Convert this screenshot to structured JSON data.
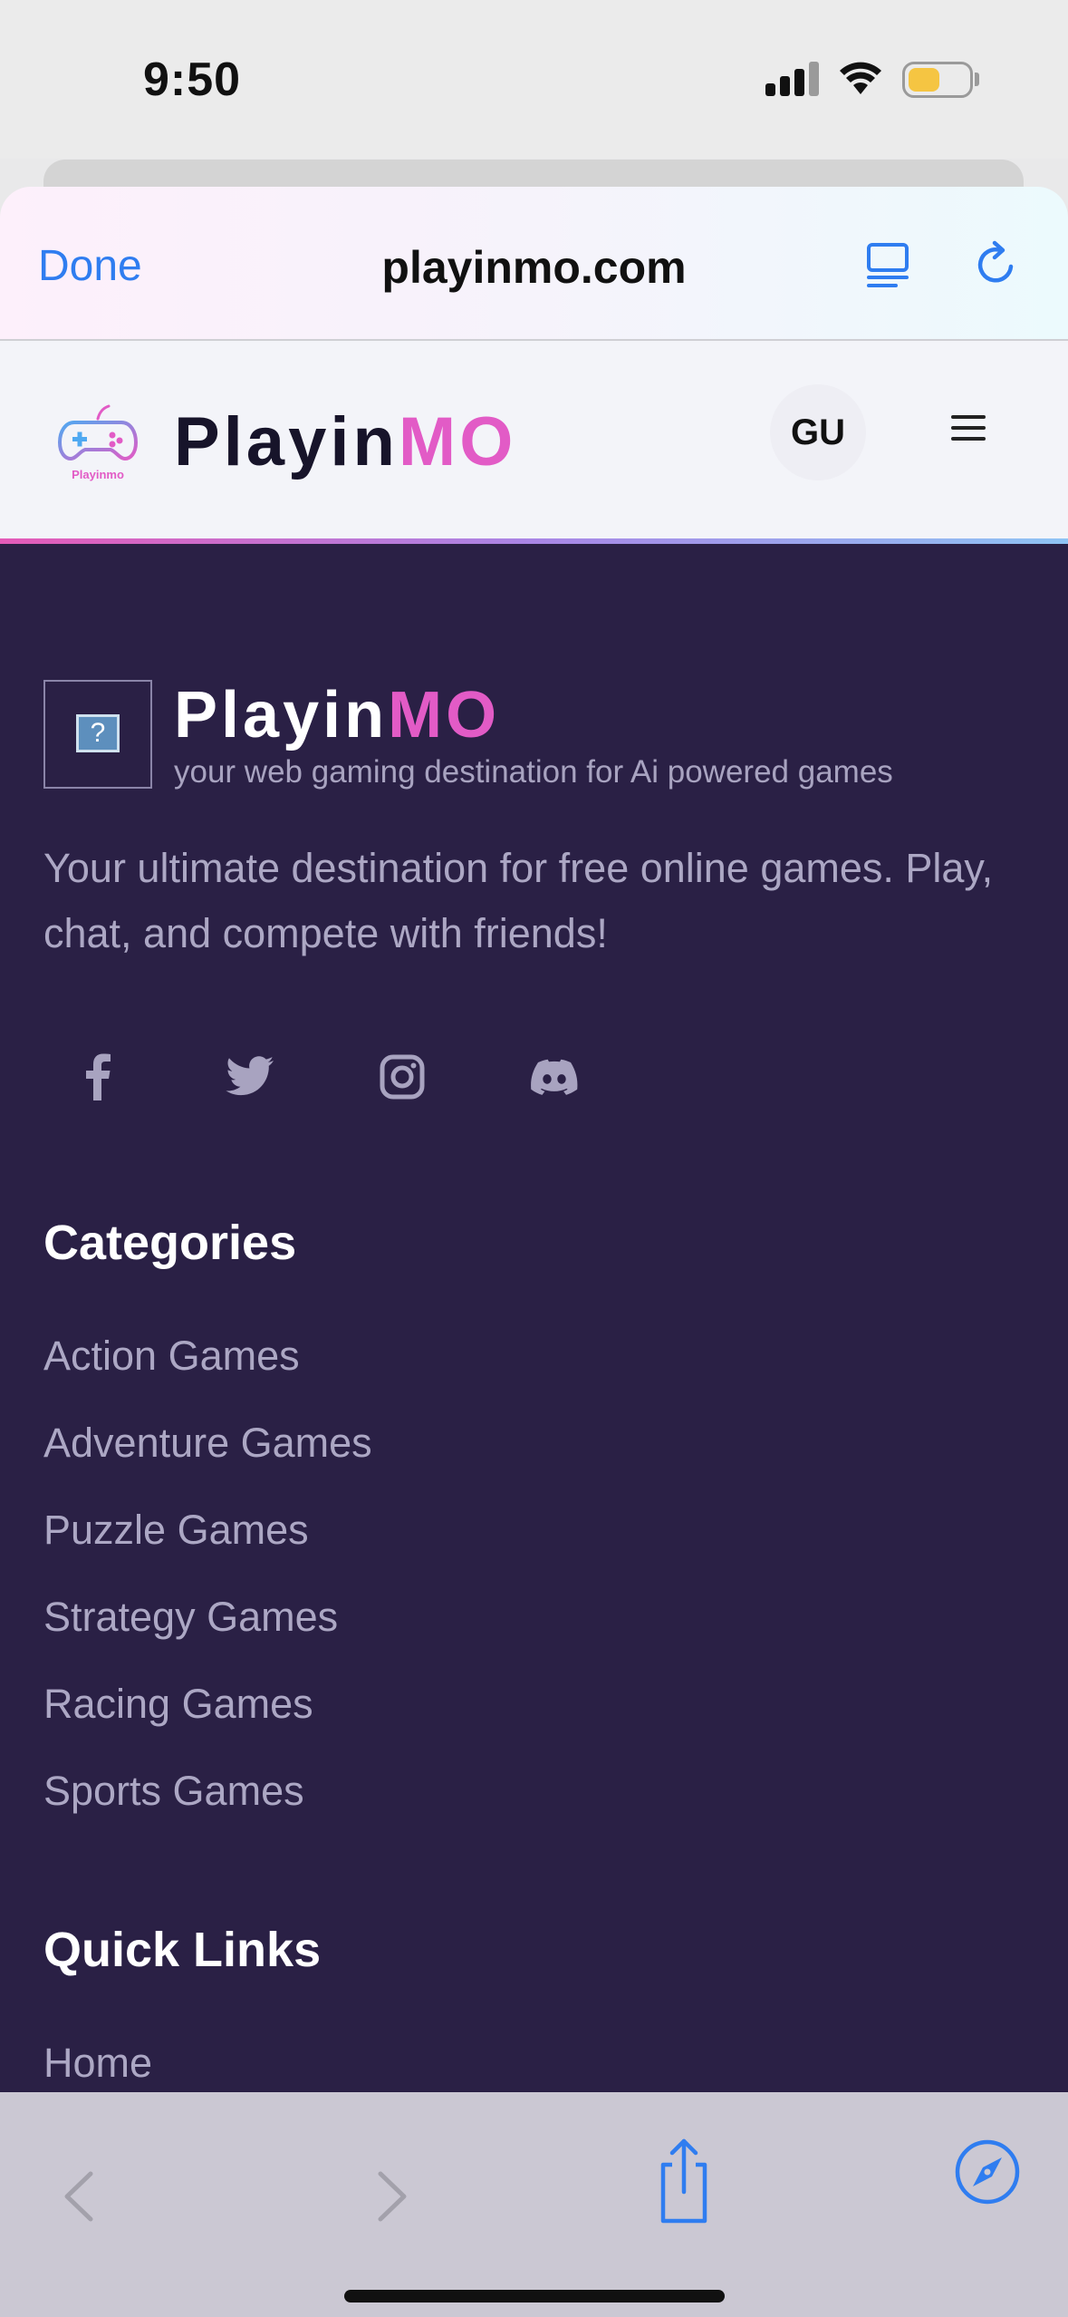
{
  "status_bar": {
    "time": "9:50"
  },
  "browser": {
    "done_label": "Done",
    "url": "playinmo.com"
  },
  "site_header": {
    "logo_part1": "Playin",
    "logo_part2": "MO",
    "logo_icon_text": "Playinmo",
    "language_label": "GU"
  },
  "footer": {
    "brand_part1": "Playin",
    "brand_part2": "MO",
    "broken_image_glyph": "?",
    "tagline": "your web gaming destination for Ai powered games",
    "description": "Your ultimate destination for free online games. Play, chat, and compete with friends!",
    "social_icons": [
      "facebook-icon",
      "twitter-icon",
      "instagram-icon",
      "discord-icon"
    ],
    "categories_title": "Categories",
    "categories": [
      "Action Games",
      "Adventure Games",
      "Puzzle Games",
      "Strategy Games",
      "Racing Games",
      "Sports Games"
    ],
    "quick_links_title": "Quick Links",
    "quick_links": [
      "Home"
    ]
  },
  "colors": {
    "accent": "#e25bc6",
    "footer_bg": "#2a2045",
    "ios_blue": "#2f7df0"
  }
}
